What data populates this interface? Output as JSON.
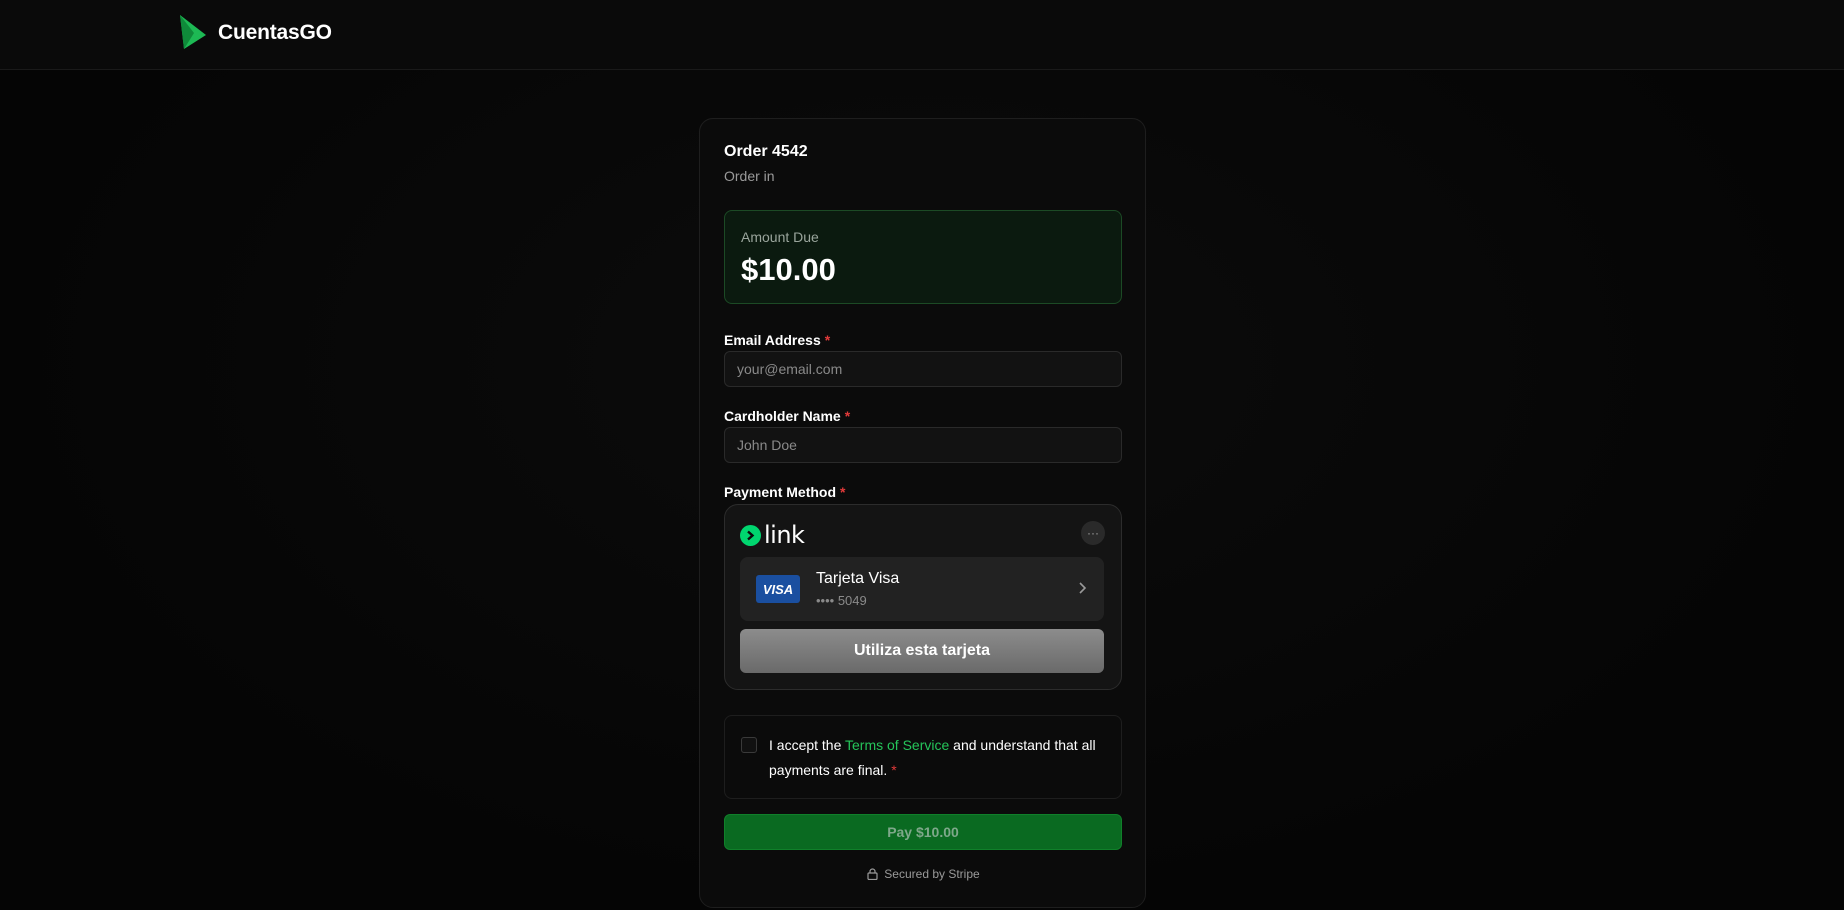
{
  "header": {
    "brand_name": "CuentasGO",
    "brand_color": "#1db954"
  },
  "order": {
    "title": "Order 4542",
    "subtitle": "Order in"
  },
  "amount": {
    "label": "Amount Due",
    "value": "$10.00"
  },
  "email": {
    "label": "Email Address",
    "required_mark": "*",
    "placeholder": "your@email.com",
    "value": ""
  },
  "cardholder": {
    "label": "Cardholder Name",
    "required_mark": "*",
    "placeholder": "John Doe",
    "value": ""
  },
  "payment": {
    "label": "Payment Method",
    "required_mark": "*",
    "link_word": "link",
    "more_label": "···",
    "card_brand": "VISA",
    "card_name": "Tarjeta Visa",
    "card_number": "•••• 5049",
    "use_button": "Utiliza esta tarjeta"
  },
  "terms": {
    "prefix": "I accept the ",
    "link": "Terms of Service",
    "suffix": " and understand that all payments are final.",
    "required_mark": "*",
    "checked": false
  },
  "pay_button": "Pay $10.00",
  "secured_text": "Secured by Stripe",
  "colors": {
    "accent_green": "#25c45a",
    "pay_green": "#0a6a21",
    "required_red": "#e23a3a",
    "link_green": "#00d66f"
  }
}
